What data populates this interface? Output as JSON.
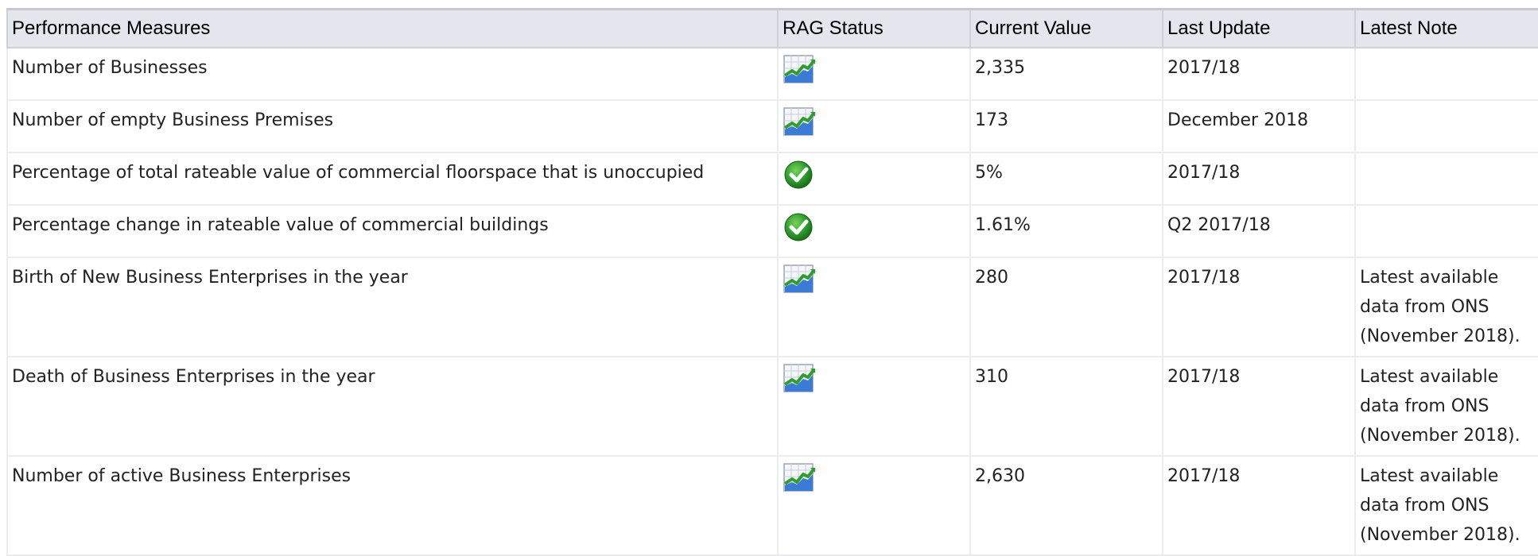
{
  "table": {
    "headers": [
      "Performance Measures",
      "RAG Status",
      "Current Value",
      "Last Update",
      "Latest Note"
    ],
    "rows": [
      {
        "measure": "Number of Businesses",
        "status_icon": "data-only-chart-icon",
        "value": "2,335",
        "last_update": "2017/18",
        "note": ""
      },
      {
        "measure": "Number of empty Business Premises",
        "status_icon": "data-only-chart-icon",
        "value": "173",
        "last_update": "December 2018",
        "note": ""
      },
      {
        "measure": "Percentage of total rateable value of commercial floorspace that is unoccupied",
        "status_icon": "green-check-icon",
        "value": "5%",
        "last_update": "2017/18",
        "note": ""
      },
      {
        "measure": "Percentage change in rateable value of commercial buildings",
        "status_icon": "green-check-icon",
        "value": "1.61%",
        "last_update": "Q2 2017/18",
        "note": ""
      },
      {
        "measure": "Birth of New Business Enterprises in the year",
        "status_icon": "data-only-chart-icon",
        "value": "280",
        "last_update": "2017/18",
        "note": "Latest available data from ONS (November 2018)."
      },
      {
        "measure": "Death of Business Enterprises in the year",
        "status_icon": "data-only-chart-icon",
        "value": "310",
        "last_update": "2017/18",
        "note": "Latest available data from ONS (November 2018)."
      },
      {
        "measure": "Number of active Business Enterprises",
        "status_icon": "data-only-chart-icon",
        "value": "2,630",
        "last_update": "2017/18",
        "note": "Latest available data from ONS (November 2018)."
      }
    ]
  },
  "colors": {
    "header_bg": "#e5e5ed",
    "check_green": "#2e9d2e",
    "chart_green": "#3aa83a",
    "chart_blue": "#3a7bd5"
  }
}
